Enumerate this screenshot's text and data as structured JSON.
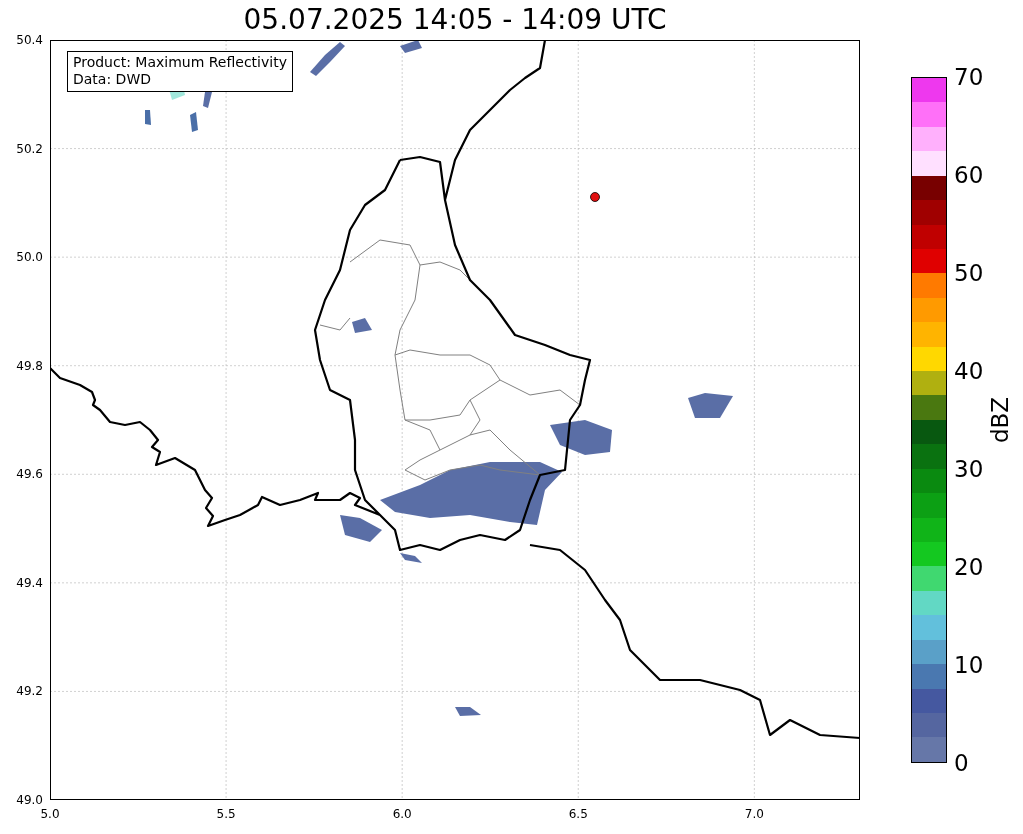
{
  "title": "05.07.2025 14:05 - 14:09 UTC",
  "info_box": {
    "lines": [
      "Product: Maximum Reflectivity",
      "Data: DWD"
    ]
  },
  "map": {
    "x_ticks": [
      "5.0",
      "5.5",
      "6.0",
      "6.5",
      "7.0"
    ],
    "y_ticks": [
      "50.4",
      "50.2",
      "50.0",
      "49.8",
      "49.6",
      "49.4",
      "49.2",
      "49.0"
    ]
  },
  "colorbar": {
    "label": "dBZ",
    "ticks": [
      "70",
      "60",
      "50",
      "40",
      "30",
      "20",
      "10",
      "0"
    ],
    "segments": [
      {
        "color": "#ee38ee"
      },
      {
        "color": "#ff70f8"
      },
      {
        "color": "#ffb0fc"
      },
      {
        "color": "#ffe0ff"
      },
      {
        "color": "#780000"
      },
      {
        "color": "#a00000"
      },
      {
        "color": "#c00000"
      },
      {
        "color": "#e00000"
      },
      {
        "color": "#ff7a00"
      },
      {
        "color": "#ff9a00"
      },
      {
        "color": "#ffb400"
      },
      {
        "color": "#ffd800"
      },
      {
        "color": "#b0b010"
      },
      {
        "color": "#4a7810"
      },
      {
        "color": "#085810"
      },
      {
        "color": "#0a7210"
      },
      {
        "color": "#0a8a10"
      },
      {
        "color": "#0ca014"
      },
      {
        "color": "#10b418"
      },
      {
        "color": "#14c820"
      },
      {
        "color": "#40d870"
      },
      {
        "color": "#62d8c4"
      },
      {
        "color": "#62c0dc"
      },
      {
        "color": "#5aa0c8"
      },
      {
        "color": "#4a78b0"
      },
      {
        "color": "#4558a0"
      },
      {
        "color": "#5566a0"
      },
      {
        "color": "#6677a8"
      }
    ]
  }
}
